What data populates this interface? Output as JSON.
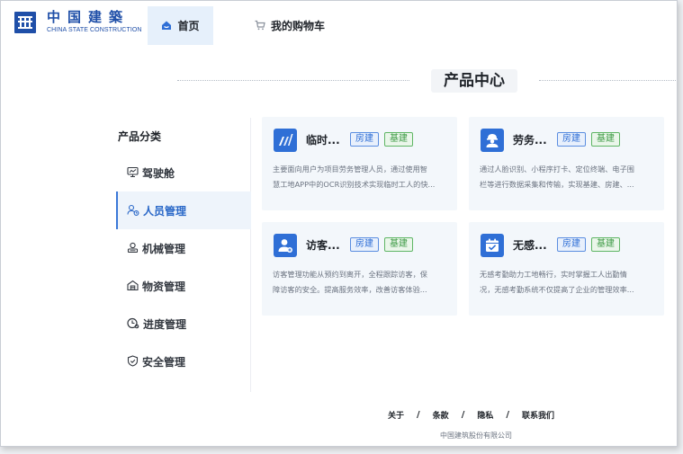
{
  "brand": {
    "name_cn": "中国建築",
    "name_en": "CHINA STATE CONSTRUCTION",
    "color": "#1f4fa8"
  },
  "nav": {
    "home_label": "首页",
    "cart_label": "我的购物车"
  },
  "page": {
    "title": "产品中心"
  },
  "sidebar": {
    "heading": "产品分类",
    "items": [
      {
        "label": "驾驶舱",
        "icon": "dashboard-icon"
      },
      {
        "label": "人员管理",
        "icon": "people-icon"
      },
      {
        "label": "机械管理",
        "icon": "machine-icon"
      },
      {
        "label": "物资管理",
        "icon": "warehouse-icon"
      },
      {
        "label": "进度管理",
        "icon": "progress-icon"
      },
      {
        "label": "安全管理",
        "icon": "shield-icon"
      }
    ],
    "active_index": 1
  },
  "cards": [
    {
      "title": "临时...",
      "icon": "bar-chart-icon",
      "tags": [
        "房建",
        "基建"
      ],
      "desc": [
        "主要面向用户为项目劳务管理人员，通过使用智",
        "慧工地APP中的OCR识别技术实现临时工人的快..."
      ]
    },
    {
      "title": "劳务...",
      "icon": "worker-icon",
      "tags": [
        "房建",
        "基建"
      ],
      "desc": [
        "通过人脸识别、小程序打卡、定位终端、电子围",
        "栏等进行数据采集和传输，实现基建、房建、..."
      ]
    },
    {
      "title": "访客...",
      "icon": "visitor-icon",
      "tags": [
        "房建",
        "基建"
      ],
      "desc": [
        "访客管理功能从预约到离开，全程跟踪访客，保",
        "障访客的安全。提高服务效率，改善访客体验..."
      ]
    },
    {
      "title": "无感...",
      "icon": "calendar-check-icon",
      "tags": [
        "房建",
        "基建"
      ],
      "desc": [
        "无感考勤助力工地畅行，实时掌握工人出勤情",
        "况，无感考勤系统不仅提高了企业的管理效率..."
      ]
    }
  ],
  "footer": {
    "links": [
      "关于",
      "条款",
      "隐私",
      "联系我们"
    ],
    "separator": "/",
    "copyright": "中国建筑股份有限公司"
  },
  "colors": {
    "accent": "#2f6fd6",
    "tag_blue": "#2f6fd6",
    "tag_green": "#3c9a44",
    "card_bg": "#f3f7fb"
  }
}
